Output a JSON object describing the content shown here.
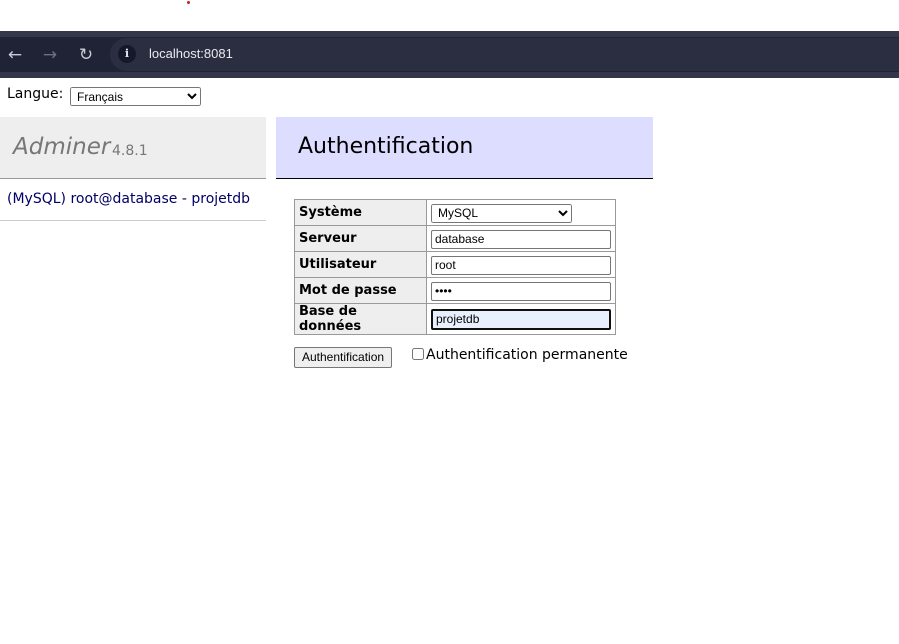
{
  "browser": {
    "url": "localhost:8081",
    "back_icon": "arrow-left-icon",
    "forward_icon": "arrow-right-icon",
    "reload_icon": "reload-icon",
    "site_info_icon": "info-icon"
  },
  "language": {
    "label": "Langue:",
    "selected": "Français"
  },
  "sidebar": {
    "app_name": "Adminer",
    "version": "4.8.1",
    "connection_link": "(MySQL) root@database - projetdb"
  },
  "main": {
    "title": "Authentification",
    "form": {
      "system_label": "Système",
      "system_value": "MySQL",
      "server_label": "Serveur",
      "server_value": "database",
      "user_label": "Utilisateur",
      "user_value": "root",
      "password_label": "Mot de passe",
      "password_value": "••••",
      "database_label": "Base de données",
      "database_value": "projetdb"
    },
    "submit_label": "Authentification",
    "permanent_label": "Authentification permanente"
  }
}
